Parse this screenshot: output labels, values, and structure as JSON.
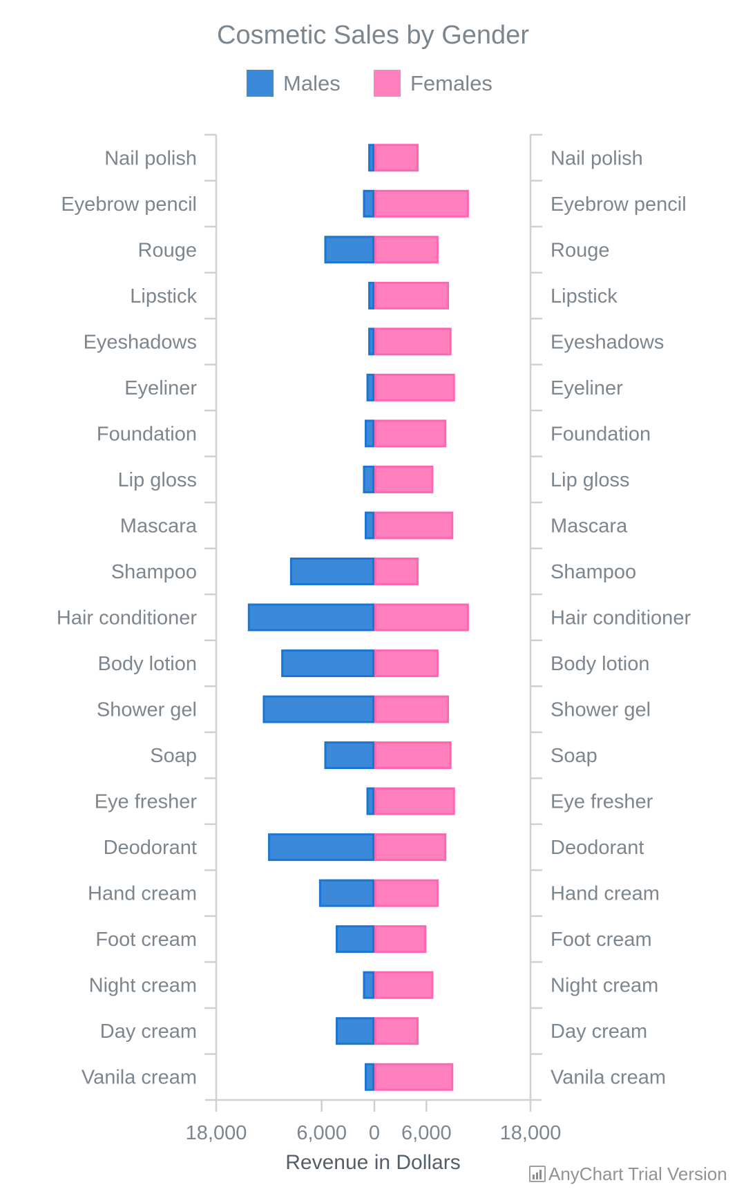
{
  "chart_data": {
    "type": "bar",
    "orientation": "horizontal",
    "variant": "diverging (population pyramid)",
    "title": "Cosmetic Sales by Gender",
    "xlabel": "Revenue in Dollars",
    "ylabel": "",
    "xlim": [
      -18000,
      18000
    ],
    "x_ticks": [
      -18000,
      -6000,
      0,
      6000,
      18000
    ],
    "x_tick_labels": [
      "18,000",
      "6,000",
      "0",
      "6,000",
      "18,000"
    ],
    "legend": {
      "placement": "top-center",
      "entries": [
        "Males",
        "Females"
      ]
    },
    "grid": false,
    "categories": [
      "Nail polish",
      "Eyebrow pencil",
      "Rouge",
      "Lipstick",
      "Eyeshadows",
      "Eyeliner",
      "Foundation",
      "Lip gloss",
      "Mascara",
      "Shampoo",
      "Hair conditioner",
      "Body lotion",
      "Shower gel",
      "Soap",
      "Eye fresher",
      "Deodorant",
      "Hand cream",
      "Foot cream",
      "Night cream",
      "Day cream",
      "Vanila cream"
    ],
    "series": [
      {
        "name": "Males",
        "side": "left",
        "color": "#3b89d8",
        "stroke": "#1976d2",
        "values": [
          700,
          1300,
          5700,
          700,
          700,
          900,
          1100,
          1300,
          1100,
          9600,
          14400,
          10600,
          12700,
          5700,
          900,
          12100,
          6300,
          4400,
          1300,
          4400,
          1100
        ]
      },
      {
        "name": "Females",
        "side": "right",
        "color": "#ff80bd",
        "stroke": "#ff66b2",
        "values": [
          5100,
          10900,
          7400,
          8600,
          8900,
          9300,
          8300,
          6800,
          9100,
          5100,
          10900,
          7400,
          8600,
          8900,
          9300,
          8300,
          7400,
          6000,
          6800,
          5100,
          9100
        ]
      }
    ]
  },
  "watermark": {
    "text": "AnyChart Trial Version",
    "icon": "bar-chart-icon"
  }
}
